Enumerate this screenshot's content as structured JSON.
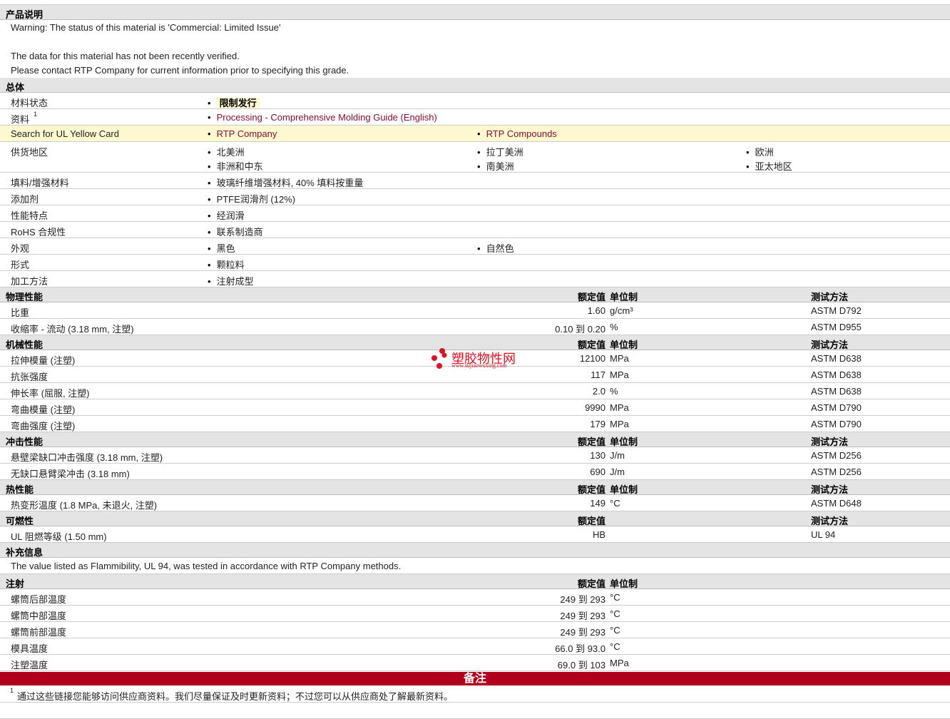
{
  "description": {
    "title": "产品说明",
    "lines": [
      "Warning: The status of this material is 'Commercial: Limited Issue'",
      "",
      "The data for this material has not been recently verified.",
      "Please contact RTP Company for current information prior to specifying this grade."
    ]
  },
  "general": {
    "title": "总体",
    "rows": [
      {
        "label": "材料状态",
        "items": [
          {
            "text": "限制发行",
            "style": "hl"
          }
        ]
      },
      {
        "label": "资料",
        "sup": "1",
        "items": [
          {
            "text": "Processing - Comprehensive Molding Guide (English)",
            "style": "link"
          }
        ]
      },
      {
        "label": "Search for UL Yellow Card",
        "yellow": true,
        "items": [
          {
            "text": "RTP Company",
            "style": "link"
          },
          {
            "text": "RTP Compounds",
            "style": "link"
          }
        ]
      },
      {
        "label": "供货地区",
        "two": true,
        "items": [
          {
            "text": "北美洲"
          },
          {
            "text": "拉丁美洲"
          },
          {
            "text": "欧洲"
          },
          {
            "text": "非洲和中东"
          },
          {
            "text": "南美洲"
          },
          {
            "text": "亚太地区"
          }
        ]
      },
      {
        "label": "填料/增强材料",
        "items": [
          {
            "text": "玻璃纤维增强材料, 40% 填料按重量"
          }
        ]
      },
      {
        "label": "添加剂",
        "items": [
          {
            "text": "PTFE润滑剂 (12%)"
          }
        ]
      },
      {
        "label": "性能特点",
        "items": [
          {
            "text": "经润滑"
          }
        ]
      },
      {
        "label": "RoHS 合规性",
        "items": [
          {
            "text": "联系制造商"
          }
        ]
      },
      {
        "label": "外观",
        "items": [
          {
            "text": "黑色"
          },
          {
            "text": "自然色"
          }
        ]
      },
      {
        "label": "形式",
        "items": [
          {
            "text": "颗粒料"
          }
        ]
      },
      {
        "label": "加工方法",
        "items": [
          {
            "text": "注射成型"
          }
        ]
      }
    ]
  },
  "sections": [
    {
      "title": "物理性能",
      "h_value": "额定值",
      "h_unit": "单位制",
      "h_method": "测试方法",
      "rows": [
        {
          "label": "比重",
          "value": "1.60",
          "unit": "g/cm³",
          "method": "ASTM D792"
        },
        {
          "label": "收缩率 - 流动 (3.18 mm, 注塑)",
          "value": "0.10 到  0.20",
          "unit": "%",
          "method": "ASTM D955"
        }
      ]
    },
    {
      "title": "机械性能",
      "h_value": "额定值",
      "h_unit": "单位制",
      "h_method": "测试方法",
      "rows": [
        {
          "label": "拉伸模量 (注塑)",
          "value": "12100",
          "unit": "MPa",
          "method": "ASTM D638"
        },
        {
          "label": "抗张强度",
          "value": "117",
          "unit": "MPa",
          "method": "ASTM D638"
        },
        {
          "label": "伸长率 (屈服, 注塑)",
          "value": "2.0",
          "unit": "%",
          "method": "ASTM D638"
        },
        {
          "label": "弯曲模量 (注塑)",
          "value": "9990",
          "unit": "MPa",
          "method": "ASTM D790"
        },
        {
          "label": "弯曲强度 (注塑)",
          "value": "179",
          "unit": "MPa",
          "method": "ASTM D790"
        }
      ]
    },
    {
      "title": "冲击性能",
      "h_value": "额定值",
      "h_unit": "单位制",
      "h_method": "测试方法",
      "rows": [
        {
          "label": "悬壁梁缺口冲击强度 (3.18 mm, 注塑)",
          "value": "130",
          "unit": "J/m",
          "method": "ASTM D256"
        },
        {
          "label": "无缺口悬臂梁冲击 (3.18 mm)",
          "value": "690",
          "unit": "J/m",
          "method": "ASTM D256"
        }
      ]
    },
    {
      "title": "热性能",
      "h_value": "额定值",
      "h_unit": "单位制",
      "h_method": "测试方法",
      "rows": [
        {
          "label": "热变形温度 (1.8 MPa, 未退火, 注塑)",
          "value": "149",
          "unit": "°C",
          "method": "ASTM D648"
        }
      ]
    },
    {
      "title": "可燃性",
      "h_value": "额定值",
      "h_method": "测试方法",
      "rows": [
        {
          "label": "UL 阻燃等级 (1.50 mm)",
          "value": "HB",
          "unit": "",
          "method": "UL 94"
        }
      ]
    },
    {
      "title": "补充信息",
      "note": "The value listed as Flammibility, UL 94, was tested in accordance with RTP Company methods."
    },
    {
      "title": "注射",
      "h_value": "额定值",
      "h_unit": "单位制",
      "rows": [
        {
          "label": "螺筒后部温度",
          "value": "249 到  293",
          "unit": "°C",
          "method": ""
        },
        {
          "label": "螺筒中部温度",
          "value": "249 到  293",
          "unit": "°C",
          "method": ""
        },
        {
          "label": "螺筒前部温度",
          "value": "249 到  293",
          "unit": "°C",
          "method": ""
        },
        {
          "label": "模具温度",
          "value": "66.0 到  93.0",
          "unit": "°C",
          "method": ""
        },
        {
          "label": "注塑温度",
          "value": "69.0 到  103",
          "unit": "MPa",
          "method": ""
        }
      ]
    }
  ],
  "notes": {
    "title": "备注",
    "footnote_mark": "1",
    "footnote": "通过这些链接您能够访问供应商资料。我们尽量保证及时更新资料；不过您可以从供应商处了解最新资料。"
  },
  "watermark": {
    "text": "塑胶物性网",
    "url": "www.sujiaowuxing.com"
  },
  "colors": {
    "accent_red": "#b0001e",
    "link": "#8a1030",
    "highlight": "#fdf8cf",
    "header_bg": "#e4e4e4"
  }
}
